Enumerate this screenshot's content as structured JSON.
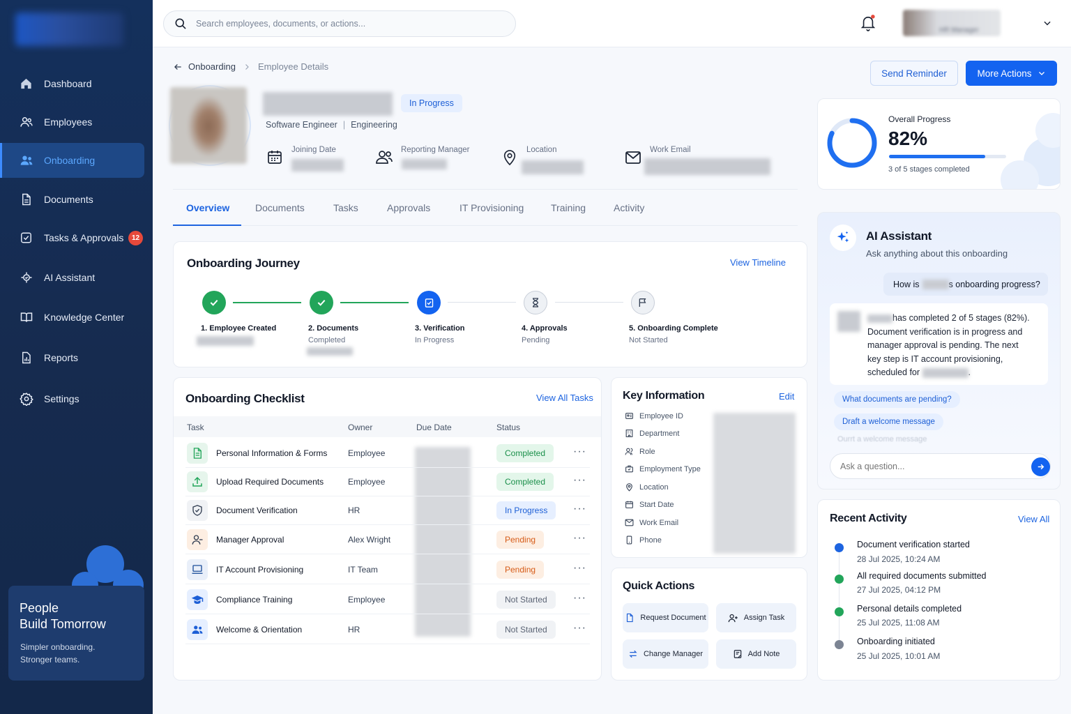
{
  "sidebar": {
    "items": [
      {
        "label": "Dashboard",
        "icon": "home-icon"
      },
      {
        "label": "Employees",
        "icon": "users-icon"
      },
      {
        "label": "Onboarding",
        "icon": "onboarding-icon",
        "active": true
      },
      {
        "label": "Documents",
        "icon": "document-icon"
      },
      {
        "label": "Tasks & Approvals",
        "icon": "checkbox-icon",
        "badge": "12"
      },
      {
        "label": "AI Assistant",
        "icon": "ai-icon"
      },
      {
        "label": "Knowledge Center",
        "icon": "book-icon"
      },
      {
        "label": "Reports",
        "icon": "report-icon"
      },
      {
        "label": "Settings",
        "icon": "gear-icon"
      }
    ],
    "promo": {
      "title_line1": "People",
      "title_line2": "Build Tomorrow",
      "text_line1": "Simpler onboarding.",
      "text_line2": "Stronger teams."
    }
  },
  "topbar": {
    "search_placeholder": "Search employees, documents, or actions...",
    "user_role": "HR Manager"
  },
  "breadcrumb": {
    "parent": "Onboarding",
    "current": "Employee Details"
  },
  "actions": {
    "send_reminder": "Send Reminder",
    "more_actions": "More Actions"
  },
  "employee": {
    "status": "In Progress",
    "title": "Software Engineer",
    "separator": "|",
    "department": "Engineering",
    "fields": {
      "joining_date_label": "Joining Date",
      "reporting_manager_label": "Reporting Manager",
      "location_label": "Location",
      "work_email_label": "Work Email"
    }
  },
  "progress": {
    "label": "Overall Progress",
    "percent_text": "82%",
    "value": 0.82,
    "sub": "3 of 5 stages completed"
  },
  "tabs": [
    "Overview",
    "Documents",
    "Tasks",
    "Approvals",
    "IT Provisioning",
    "Training",
    "Activity"
  ],
  "journey": {
    "title": "Onboarding Journey",
    "link": "View Timeline",
    "steps": [
      {
        "title": "1. Employee Created",
        "sub": "",
        "state": "done"
      },
      {
        "title": "2. Documents",
        "sub": "Completed",
        "state": "done"
      },
      {
        "title": "3. Verification",
        "sub": "In Progress",
        "state": "current"
      },
      {
        "title": "4. Approvals",
        "sub": "Pending",
        "state": "pending"
      },
      {
        "title": "5. Onboarding Complete",
        "sub": "Not Started",
        "state": "pending"
      }
    ]
  },
  "checklist": {
    "title": "Onboarding Checklist",
    "link": "View All Tasks",
    "headers": [
      "Task",
      "Owner",
      "Due Date",
      "Status"
    ],
    "rows": [
      {
        "task": "Personal Information & Forms",
        "owner": "Employee",
        "status": "Completed",
        "tone": "green",
        "icon": "form-icon"
      },
      {
        "task": "Upload Required Documents",
        "owner": "Employee",
        "status": "Completed",
        "tone": "green",
        "icon": "upload-icon"
      },
      {
        "task": "Document Verification",
        "owner": "HR",
        "status": "In Progress",
        "tone": "blue",
        "icon": "shield-icon"
      },
      {
        "task": "Manager Approval",
        "owner": "Alex Wright",
        "status": "Pending",
        "tone": "orange",
        "icon": "user-check-icon"
      },
      {
        "task": "IT Account Provisioning",
        "owner": "IT Team",
        "status": "Pending",
        "tone": "orange",
        "icon": "laptop-icon"
      },
      {
        "task": "Compliance Training",
        "owner": "Employee",
        "status": "Not Started",
        "tone": "gray",
        "icon": "graduation-cap-icon"
      },
      {
        "task": "Welcome & Orientation",
        "owner": "HR",
        "status": "Not Started",
        "tone": "gray",
        "icon": "team-icon"
      }
    ],
    "more": "···"
  },
  "key_info": {
    "title": "Key Information",
    "link": "Edit",
    "labels": [
      "Employee ID",
      "Department",
      "Role",
      "Employment Type",
      "Location",
      "Start Date",
      "Work Email",
      "Phone"
    ]
  },
  "quick_actions": {
    "title": "Quick Actions",
    "items": [
      "Request Document",
      "Assign Task",
      "Change Manager",
      "Add Note"
    ]
  },
  "ai": {
    "title": "AI Assistant",
    "subtitle": "Ask anything about this onboarding",
    "question_pre": "How is",
    "question_post": "s onboarding progress?",
    "answer_line1": "has completed 2 of 5 stages (82%).",
    "answer_line2": "Document verification is in progress and",
    "answer_line3": "manager approval is pending. The next",
    "answer_line4": "key step is IT account provisioning,",
    "answer_line5": "scheduled for",
    "answer_end": ".",
    "chips": [
      "What documents are pending?",
      "Draft a welcome message"
    ],
    "ghost": "Ourrt a welcome message",
    "input_placeholder": "Ask a question..."
  },
  "activity": {
    "title": "Recent Activity",
    "link": "View All",
    "items": [
      {
        "title": "Document verification started",
        "date": "28 Jul 2025, 10:24 AM",
        "color": "#1d64e0"
      },
      {
        "title": "All required documents submitted",
        "date": "27 Jul 2025, 04:12 PM",
        "color": "#22a55a"
      },
      {
        "title": "Personal details completed",
        "date": "25 Jul 2025, 11:08 AM",
        "color": "#22a55a"
      },
      {
        "title": "Onboarding initiated",
        "date": "25 Jul 2025, 10:01 AM",
        "color": "#7c8493"
      }
    ]
  },
  "colors": {
    "accent": "#1363f0",
    "sidebar": "#162b4f",
    "success": "#22a55a",
    "warning": "#d65b17"
  }
}
